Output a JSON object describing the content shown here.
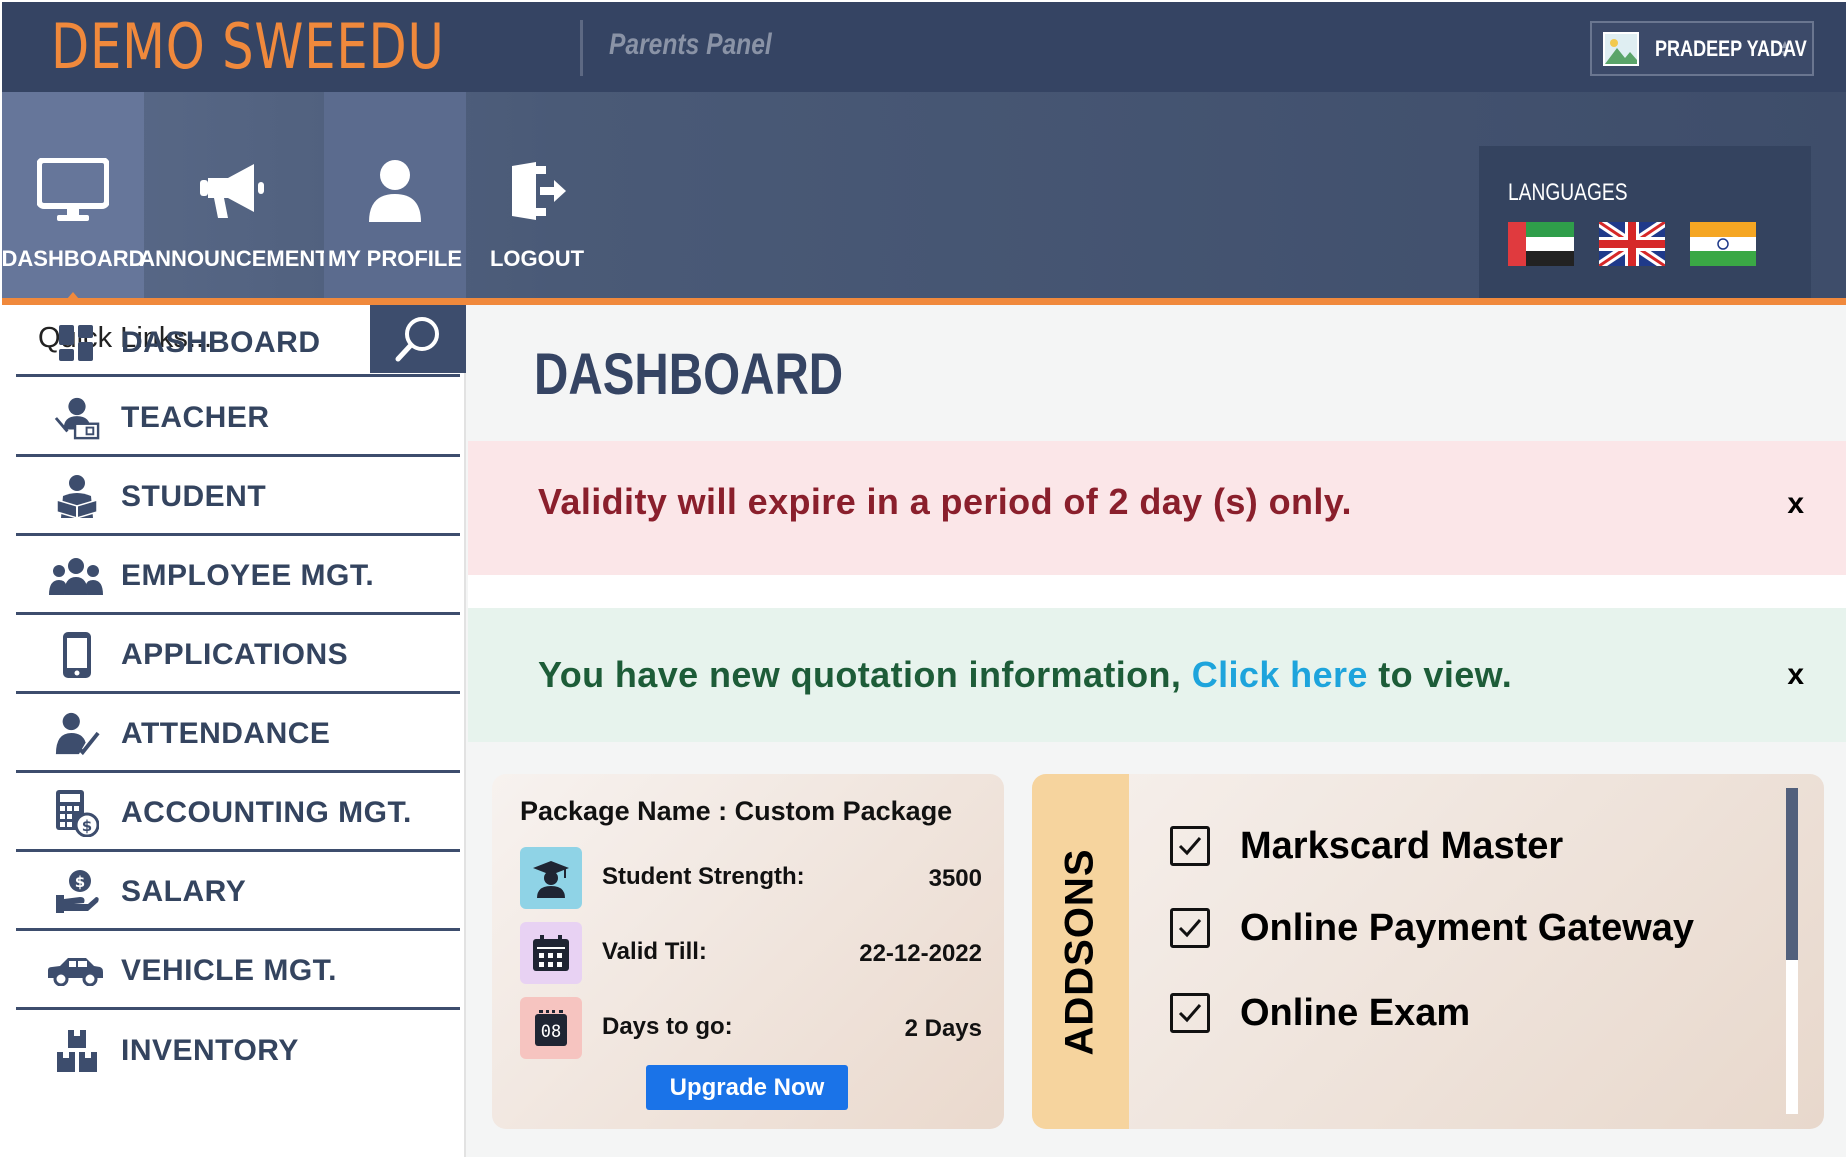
{
  "header": {
    "logo": "DEMO SWEEDU",
    "panel_title": "Parents Panel",
    "user_name": "PRADEEP YADAV"
  },
  "nav": {
    "items": [
      {
        "label": "DASHBOARD",
        "icon": "monitor-icon",
        "active": true
      },
      {
        "label": "ANNOUNCEMENT",
        "icon": "megaphone-icon"
      },
      {
        "label": "MY PROFILE",
        "icon": "user-icon"
      },
      {
        "label": "LOGOUT",
        "icon": "logout-icon"
      }
    ]
  },
  "languages": {
    "title": "LANGUAGES",
    "flags": [
      "uae-flag-icon",
      "uk-flag-icon",
      "india-flag-icon"
    ]
  },
  "sidebar": {
    "search_placeholder": "Quick Links...",
    "items": [
      {
        "label": "DASHBOARD",
        "icon": "grid-icon"
      },
      {
        "label": "TEACHER",
        "icon": "teacher-icon"
      },
      {
        "label": "STUDENT",
        "icon": "student-icon"
      },
      {
        "label": "EMPLOYEE MGT.",
        "icon": "group-icon"
      },
      {
        "label": "APPLICATIONS",
        "icon": "mobile-icon"
      },
      {
        "label": "ATTENDANCE",
        "icon": "attendance-icon"
      },
      {
        "label": "ACCOUNTING MGT.",
        "icon": "calculator-icon"
      },
      {
        "label": "SALARY",
        "icon": "salary-icon"
      },
      {
        "label": "VEHICLE MGT.",
        "icon": "car-icon"
      },
      {
        "label": "INVENTORY",
        "icon": "boxes-icon"
      }
    ]
  },
  "main": {
    "title": "DASHBOARD",
    "alerts": {
      "validity": "Validity will expire in a period of 2 day (s) only.",
      "quotation_prefix": "You have new quotation information, ",
      "quotation_link": "Click here",
      "quotation_suffix": " to view.",
      "close": "x"
    },
    "package": {
      "title": "Package Name : Custom Package",
      "rows": [
        {
          "label": "Student Strength:",
          "value": "3500"
        },
        {
          "label": "Valid Till:",
          "value": "22-12-2022"
        },
        {
          "label": "Days to go:",
          "value": "2 Days"
        }
      ],
      "calendar_day": "08",
      "button": "Upgrade Now"
    },
    "addons": {
      "label": "ADDSONS",
      "items": [
        "Markscard Master",
        "Online Payment Gateway",
        "Online Exam"
      ]
    }
  },
  "colors": {
    "header_bg": "#354463",
    "accent_orange": "#f0893c",
    "alert_danger_text": "#8a1f2c",
    "alert_success_text": "#1d5c38",
    "link": "#1ea4dc",
    "button_blue": "#1a73e8"
  }
}
